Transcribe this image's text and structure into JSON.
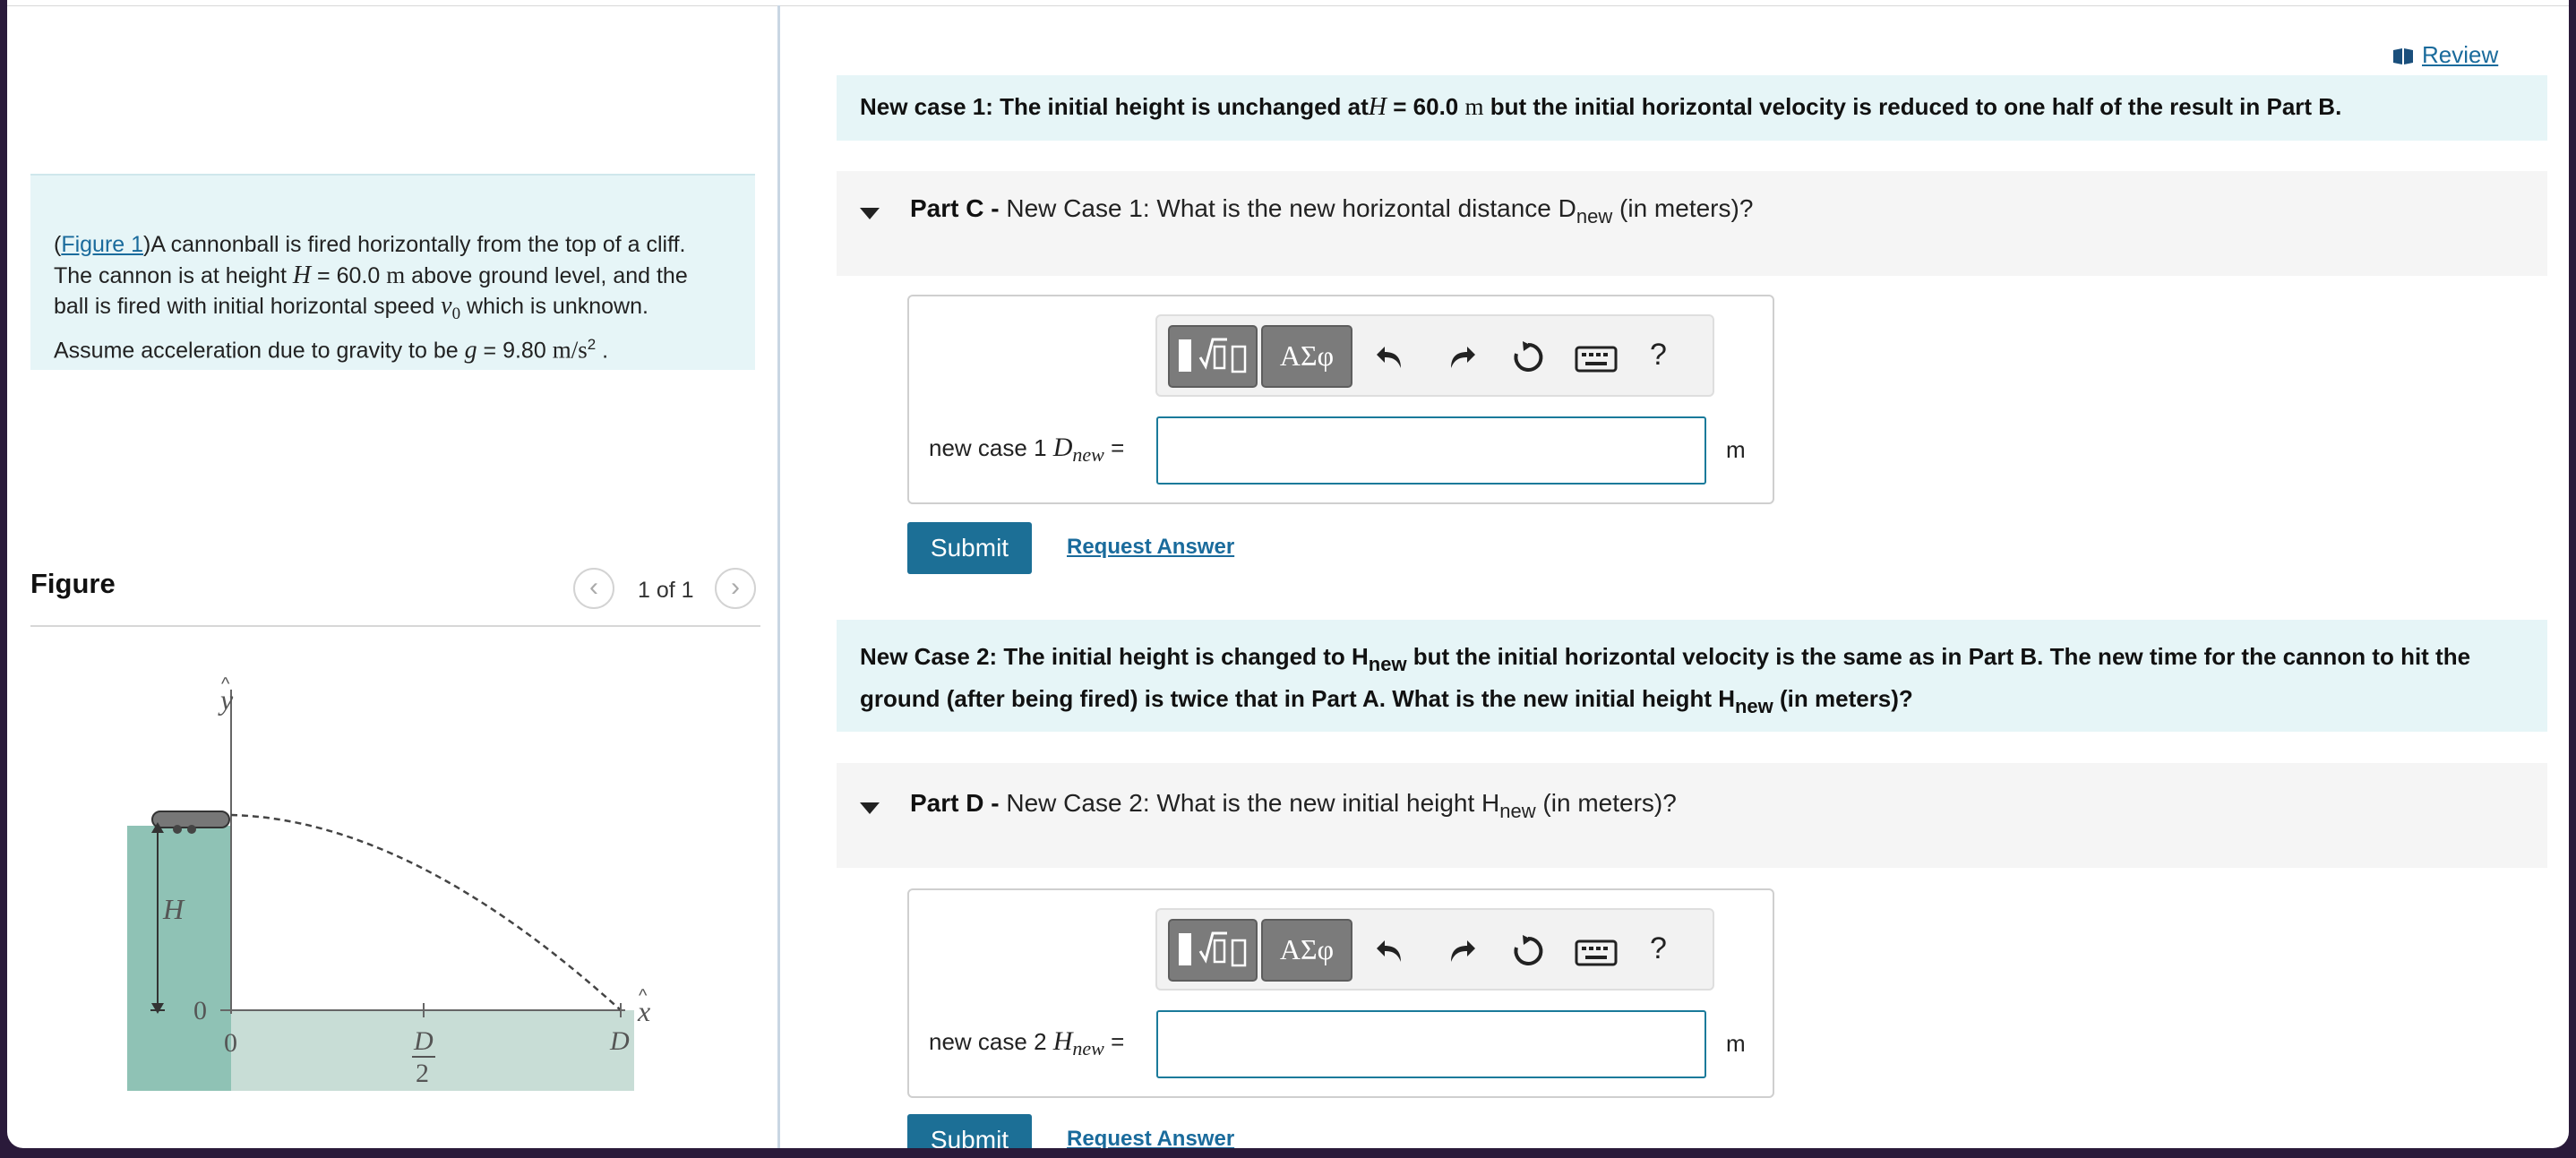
{
  "review": {
    "label": "Review"
  },
  "intro": {
    "figure_link": "Figure 1",
    "line1_rest": ")A cannonball is fired horizontally from the top of a cliff.",
    "line2_pre": "The cannon is at height ",
    "line2_var": "H",
    "line2_eq": " = 60.0 ",
    "line2_unit": "m",
    "line2_post": " above ground level, and the",
    "line3_pre": "ball is fired with initial horizontal speed ",
    "line3_var": "v",
    "line3_sub": "0",
    "line3_post": " which is unknown.",
    "line4_pre": "Assume acceleration due to gravity to be ",
    "line4_var": "g",
    "line4_eq": " = 9.80 ",
    "line4_unit": "m/s",
    "line4_exp": "2",
    "line4_post": " ."
  },
  "figure_panel": {
    "title": "Figure",
    "pager": "1 of 1"
  },
  "figure": {
    "labels": {
      "y_axis": "y",
      "x_axis": "x",
      "height": "H",
      "origin_y": "0",
      "origin_x": "0",
      "d_num": "D",
      "d_den": "2",
      "d_end": "D"
    },
    "colors": {
      "cliff": "#8fc2b5",
      "ground": "#c8ddd6",
      "trajectory": "#444444"
    }
  },
  "case1": {
    "pre": "New case 1: The initial  height is unchanged at",
    "var": "H",
    "mid": " = 60.0 ",
    "unit": "m",
    "post": " but the initial horizontal velocity is  reduced to one half of the result in Part B."
  },
  "partC": {
    "label": "Part C -",
    "text": " New Case 1: What is the new horizontal distance D",
    "sub": "new",
    "post": " (in meters)?"
  },
  "answerC": {
    "label_text": "new case 1 ",
    "var": "D",
    "sub": "new",
    "eq": " =",
    "unit": "m"
  },
  "case2": {
    "pre": "New Case 2: The initial height is changed to H",
    "sub1": "new",
    "mid": " but the initial horizontal velocity is the same as in Part B. The new time for the cannon to hit the",
    "line2": "ground (after being fired) is twice that in Part A. What is the new initial height H",
    "sub2": "new",
    "post": " (in meters)?"
  },
  "partD": {
    "label": "Part D -",
    "text": " New Case 2: What is the new initial height H",
    "sub": "new",
    "post": " (in meters)?"
  },
  "answerD": {
    "label_text": "new case 2 ",
    "var": "H",
    "sub": "new",
    "eq": " =",
    "unit": "m"
  },
  "toolbar": {
    "greek_label": "ΑΣφ",
    "help_label": "?",
    "icons": [
      "templates-icon",
      "greek-letters-icon",
      "undo-icon",
      "redo-icon",
      "reset-icon",
      "keyboard-icon",
      "help-icon"
    ]
  },
  "buttons": {
    "submit": "Submit",
    "request_answer": "Request Answer"
  },
  "colors": {
    "accent": "#1c6f96",
    "link": "#1a6b9c",
    "info_bg": "#e6f5f7",
    "part_bg": "#f5f5f5"
  }
}
